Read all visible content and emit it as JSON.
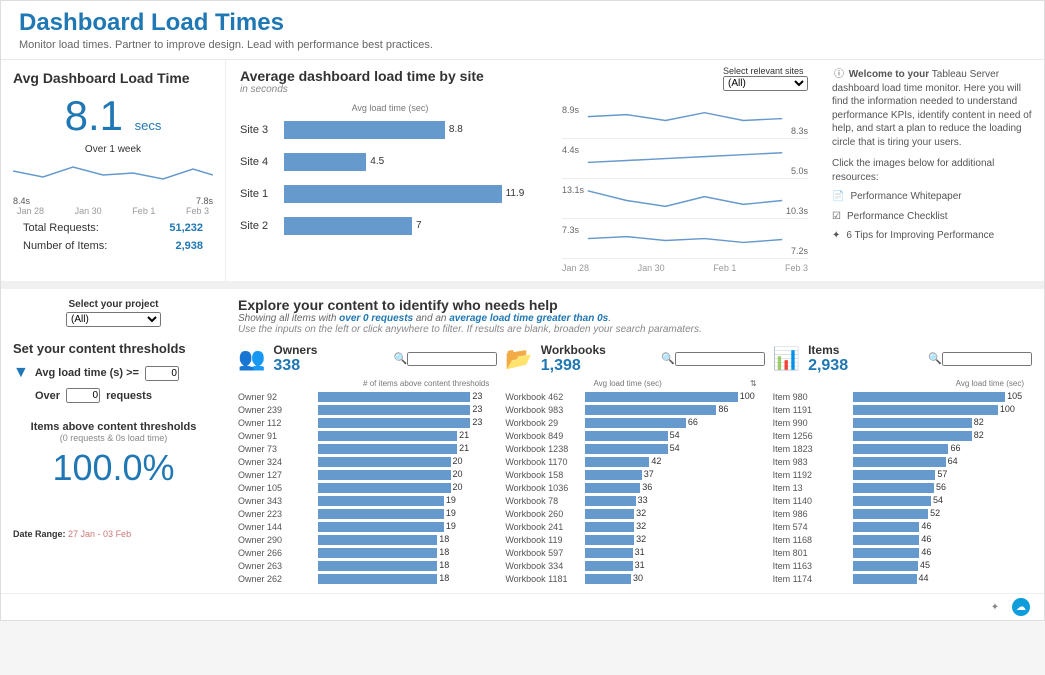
{
  "header": {
    "title": "Dashboard Load Times",
    "subtitle": "Monitor load times. Partner to improve design. Lead with performance best practices."
  },
  "kpi": {
    "title": "Avg Dashboard Load Time",
    "value": "8.1",
    "unit": "secs",
    "spark_label": "Over 1 week",
    "spark_start": "8.4s",
    "spark_end": "7.8s",
    "axis": [
      "Jan 28",
      "Jan 30",
      "Feb 1",
      "Feb 3"
    ],
    "requests_label": "Total Requests:",
    "requests": "51,232",
    "items_label": "Number of Items:",
    "items": "2,938"
  },
  "site": {
    "title": "Average dashboard load time by site",
    "sub": "in seconds",
    "bar_head": "Avg load time (sec)",
    "filter_label": "Select relevant sites",
    "filter_value": "(All)",
    "bars": [
      {
        "label": "Site 3",
        "val": 8.8
      },
      {
        "label": "Site 4",
        "val": 4.5
      },
      {
        "label": "Site 1",
        "val": 11.9
      },
      {
        "label": "Site 2",
        "val": 7.0
      }
    ],
    "lines": [
      {
        "start": "8.9s",
        "end": "8.3s"
      },
      {
        "start": "4.4s",
        "end": "5.0s"
      },
      {
        "start": "13.1s",
        "end": "10.3s"
      },
      {
        "start": "7.3s",
        "end": "7.2s"
      }
    ],
    "line_axis": [
      "Jan 28",
      "Jan 30",
      "Feb 1",
      "Feb 3"
    ]
  },
  "info": {
    "welcome_bold": "Welcome to your",
    "welcome_rest": " Tableau Server dashboard load time monitor. Here you will find the information needed to understand performance KPIs, identify content in need of help, and start a plan to reduce the loading circle that is tiring your users.",
    "click": "Click the images below for additional resources:",
    "links": [
      {
        "icon": "📄",
        "label": "Performance Whitepaper"
      },
      {
        "icon": "☑",
        "label": "Performance Checklist"
      },
      {
        "icon": "✦",
        "label": "6 Tips for Improving Performance"
      }
    ]
  },
  "left": {
    "proj_head": "Select your project",
    "proj_value": "(All)",
    "thresh_title": "Set your content thresholds",
    "avg_label": "Avg load time (s) >=",
    "avg_val": "0",
    "over_label": "Over",
    "over_val": "0",
    "over_suffix": "requests",
    "above_label": "Items above content thresholds",
    "above_sub": "(0 requests & 0s load time)",
    "above_val": "100.0%",
    "date_label": "Date Range:",
    "date_val": "27 Jan - 03 Feb"
  },
  "explore": {
    "title": "Explore your content to identify who needs help",
    "sub_pre": "Showing all items with ",
    "sub_b1": "over 0 requests",
    "sub_mid": " and an ",
    "sub_b2": "average load time greater than 0s",
    "sub_post": ".",
    "sub2": "Use the inputs on the left or click anywhere to filter. If results are blank, broaden your search paramaters.",
    "owners": {
      "title": "Owners",
      "count": "338",
      "meta": "# of items above content thresholds",
      "max": 23,
      "rows": [
        [
          "Owner 92",
          23
        ],
        [
          "Owner 239",
          23
        ],
        [
          "Owner 112",
          23
        ],
        [
          "Owner 91",
          21
        ],
        [
          "Owner 73",
          21
        ],
        [
          "Owner 324",
          20
        ],
        [
          "Owner 127",
          20
        ],
        [
          "Owner 105",
          20
        ],
        [
          "Owner 343",
          19
        ],
        [
          "Owner 223",
          19
        ],
        [
          "Owner 144",
          19
        ],
        [
          "Owner 290",
          18
        ],
        [
          "Owner 266",
          18
        ],
        [
          "Owner 263",
          18
        ],
        [
          "Owner 262",
          18
        ]
      ]
    },
    "workbooks": {
      "title": "Workbooks",
      "count": "1,398",
      "meta": "Avg load time (sec)",
      "max": 100,
      "rows": [
        [
          "Workbook 462",
          100
        ],
        [
          "Workbook 983",
          86
        ],
        [
          "Workbook 29",
          66
        ],
        [
          "Workbook 849",
          54
        ],
        [
          "Workbook 1238",
          54
        ],
        [
          "Workbook 1170",
          42
        ],
        [
          "Workbook 158",
          37
        ],
        [
          "Workbook 1036",
          36
        ],
        [
          "Workbook 78",
          33
        ],
        [
          "Workbook 260",
          32
        ],
        [
          "Workbook 241",
          32
        ],
        [
          "Workbook 119",
          32
        ],
        [
          "Workbook 597",
          31
        ],
        [
          "Workbook 334",
          31
        ],
        [
          "Workbook 1181",
          30
        ]
      ]
    },
    "items": {
      "title": "Items",
      "count": "2,938",
      "meta": "Avg load time (sec)",
      "max": 105,
      "rows": [
        [
          "Item 980",
          105
        ],
        [
          "Item 1191",
          100
        ],
        [
          "Item 990",
          82
        ],
        [
          "Item 1256",
          82
        ],
        [
          "Item 1823",
          66
        ],
        [
          "Item 983",
          64
        ],
        [
          "Item 1192",
          57
        ],
        [
          "Item 13",
          56
        ],
        [
          "Item 1140",
          54
        ],
        [
          "Item 986",
          52
        ],
        [
          "Item 574",
          46
        ],
        [
          "Item 1168",
          46
        ],
        [
          "Item 801",
          46
        ],
        [
          "Item 1163",
          45
        ],
        [
          "Item 1174",
          44
        ]
      ]
    }
  },
  "chart_data": {
    "kpi_spark": {
      "type": "line",
      "x": [
        "Jan 28",
        "Jan 30",
        "Feb 1",
        "Feb 3"
      ],
      "start": 8.4,
      "end": 7.8
    },
    "site_bars": {
      "type": "bar",
      "title": "Average dashboard load time by site",
      "ylabel": "Avg load time (sec)",
      "categories": [
        "Site 3",
        "Site 4",
        "Site 1",
        "Site 2"
      ],
      "values": [
        8.8,
        4.5,
        11.9,
        7.0
      ]
    },
    "site_lines": {
      "type": "line",
      "x": [
        "Jan 28",
        "Jan 30",
        "Feb 1",
        "Feb 3"
      ],
      "series": [
        {
          "name": "Site 3",
          "start": 8.9,
          "end": 8.3
        },
        {
          "name": "Site 4",
          "start": 4.4,
          "end": 5.0
        },
        {
          "name": "Site 1",
          "start": 13.1,
          "end": 10.3
        },
        {
          "name": "Site 2",
          "start": 7.3,
          "end": 7.2
        }
      ]
    },
    "owners": {
      "type": "bar",
      "xlabel": "# of items above content thresholds",
      "categories": [
        "Owner 92",
        "Owner 239",
        "Owner 112",
        "Owner 91",
        "Owner 73",
        "Owner 324",
        "Owner 127",
        "Owner 105",
        "Owner 343",
        "Owner 223",
        "Owner 144",
        "Owner 290",
        "Owner 266",
        "Owner 263",
        "Owner 262"
      ],
      "values": [
        23,
        23,
        23,
        21,
        21,
        20,
        20,
        20,
        19,
        19,
        19,
        18,
        18,
        18,
        18
      ]
    },
    "workbooks": {
      "type": "bar",
      "xlabel": "Avg load time (sec)",
      "categories": [
        "Workbook 462",
        "Workbook 983",
        "Workbook 29",
        "Workbook 849",
        "Workbook 1238",
        "Workbook 1170",
        "Workbook 158",
        "Workbook 1036",
        "Workbook 78",
        "Workbook 260",
        "Workbook 241",
        "Workbook 119",
        "Workbook 597",
        "Workbook 334",
        "Workbook 1181"
      ],
      "values": [
        100,
        86,
        66,
        54,
        54,
        42,
        37,
        36,
        33,
        32,
        32,
        32,
        31,
        31,
        30
      ]
    },
    "items": {
      "type": "bar",
      "xlabel": "Avg load time (sec)",
      "categories": [
        "Item 980",
        "Item 1191",
        "Item 990",
        "Item 1256",
        "Item 1823",
        "Item 983",
        "Item 1192",
        "Item 13",
        "Item 1140",
        "Item 986",
        "Item 574",
        "Item 1168",
        "Item 801",
        "Item 1163",
        "Item 1174"
      ],
      "values": [
        105,
        100,
        82,
        82,
        66,
        64,
        57,
        56,
        54,
        52,
        46,
        46,
        46,
        45,
        44
      ]
    }
  }
}
